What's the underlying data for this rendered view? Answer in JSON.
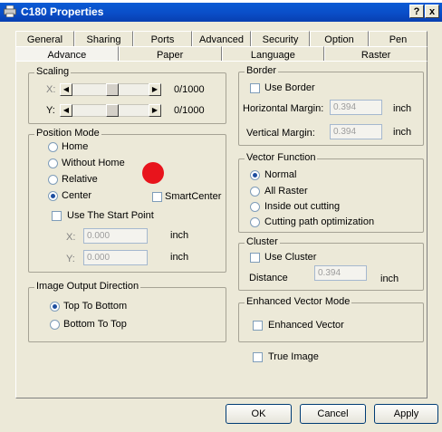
{
  "window": {
    "title": "C180 Properties",
    "help_button": "?",
    "close_button": "x"
  },
  "tabs_row1": [
    "General",
    "Sharing",
    "Ports",
    "Advanced",
    "Security",
    "Option",
    "Pen"
  ],
  "tabs_row2": [
    "Advance",
    "Paper",
    "Language",
    "Raster"
  ],
  "active_tab": "Advance",
  "scaling": {
    "title": "Scaling",
    "x_label": "X:",
    "y_label": "Y:",
    "x_value": "0/1000",
    "y_value": "0/1000"
  },
  "position_mode": {
    "title": "Position Mode",
    "options": [
      "Home",
      "Without Home",
      "Relative",
      "Center"
    ],
    "selected": "Center",
    "smartcenter_label": "SmartCenter",
    "use_start_point_label": "Use The Start Point",
    "x_label": "X:",
    "y_label": "Y:",
    "x_value": "0.000",
    "y_value": "0.000",
    "unit": "inch"
  },
  "image_output": {
    "title": "Image Output Direction",
    "options": [
      "Top To Bottom",
      "Bottom To Top"
    ],
    "selected": "Top To Bottom"
  },
  "border": {
    "title": "Border",
    "use_border_label": "Use Border",
    "horizontal_label": "Horizontal Margin:",
    "vertical_label": "Vertical Margin:",
    "horizontal_value": "0.394",
    "vertical_value": "0.394",
    "unit": "inch"
  },
  "vector_function": {
    "title": "Vector Function",
    "options": [
      "Normal",
      "All Raster",
      "Inside out cutting",
      "Cutting path optimization"
    ],
    "selected": "Normal"
  },
  "cluster": {
    "title": "Cluster",
    "use_cluster_label": "Use Cluster",
    "distance_label": "Distance",
    "distance_value": "0.394",
    "unit": "inch"
  },
  "enhanced_vector": {
    "title": "Enhanced Vector Mode",
    "checkbox_label": "Enhanced Vector"
  },
  "true_image_label": "True Image",
  "buttons": {
    "ok": "OK",
    "cancel": "Cancel",
    "apply": "Apply"
  }
}
